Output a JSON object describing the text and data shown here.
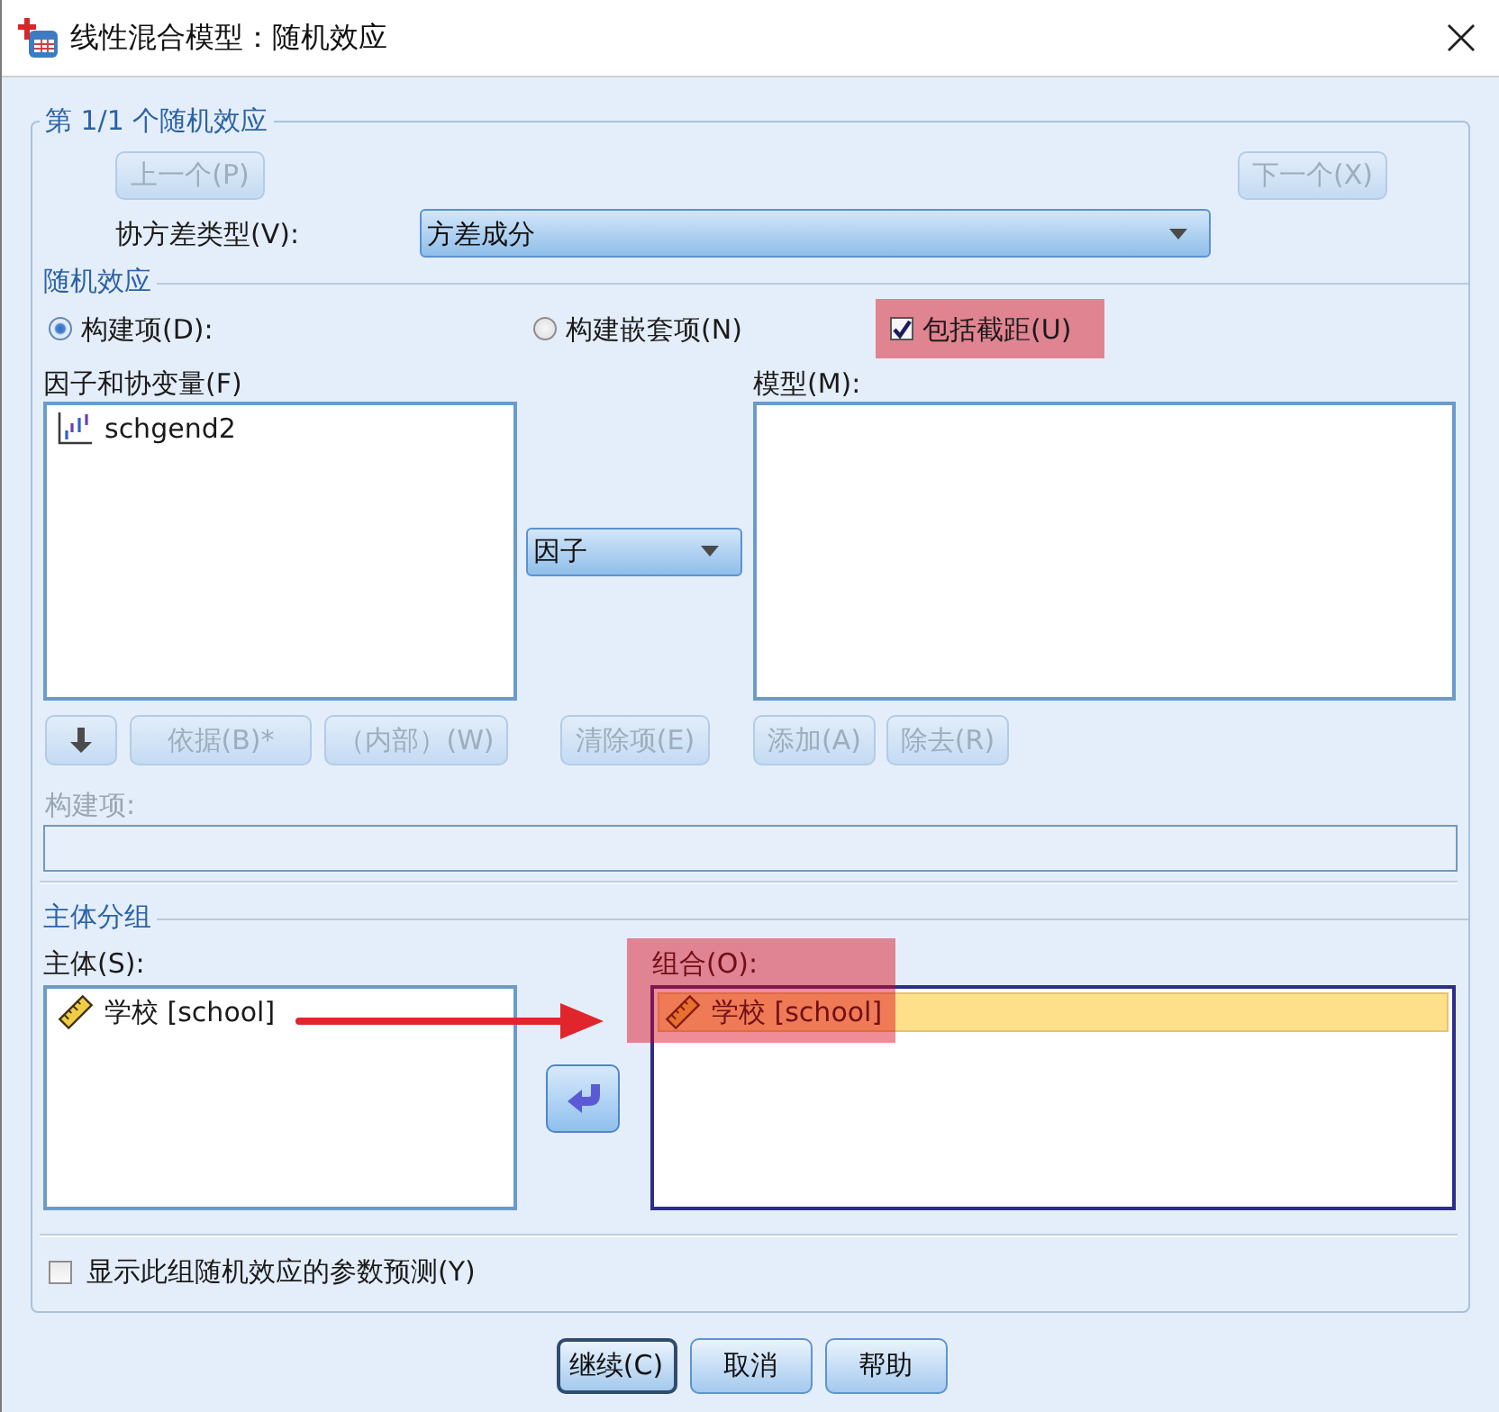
{
  "window": {
    "title": "线性混合模型：随机效应"
  },
  "effect_group": {
    "title": "第 1/1 个随机效应",
    "navigation": [
      {
        "label": "上一个(P)",
        "disabled": true
      },
      {
        "label": "下一个(X)",
        "disabled": true
      }
    ],
    "covariance_type": {
      "label": "协方差类型(V):",
      "value": "方差成分"
    }
  },
  "random_effects": {
    "title": "随机效应",
    "build_options": [
      {
        "label": "构建项(D):",
        "selected": true
      },
      {
        "label": "构建嵌套项(N)",
        "selected": false
      }
    ],
    "include_intercept": {
      "label": "包括截距(U)",
      "checked": true,
      "highlighted": true
    },
    "factors": {
      "label": "因子和协变量(F)",
      "items": [
        {
          "name": "schgend2",
          "kind": "ordinal",
          "selected": false
        }
      ],
      "buttons": [
        {
          "kind": "down_arrow",
          "disabled": true
        },
        {
          "kind": "text",
          "label": "依据(B)*",
          "disabled": true
        },
        {
          "kind": "text",
          "label": "（内部）(W)",
          "disabled": true
        }
      ]
    },
    "term_type": {
      "value": "因子",
      "buttons": [
        {
          "label": "清除项(E)",
          "disabled": true
        }
      ]
    },
    "model": {
      "label": "模型(M):",
      "buttons": [
        {
          "label": "添加(A)",
          "disabled": true
        },
        {
          "label": "除去(R)",
          "disabled": true
        }
      ]
    },
    "build_term": {
      "label": "构建项:",
      "disabled": true
    }
  },
  "subject_grouping": {
    "title": "主体分组",
    "subjects": {
      "label": "主体(S):",
      "items": [
        {
          "name": "学校 [school]",
          "kind": "scale",
          "selected": false
        }
      ]
    },
    "move_button": {
      "disabled": false
    },
    "combinations": {
      "label": "组合(O):",
      "highlighted": true,
      "focused": true,
      "items": [
        {
          "name": "学校 [school]",
          "kind": "scale",
          "selected": true
        }
      ]
    },
    "annotation_arrow": true
  },
  "show_predictions": {
    "label": "显示此组随机效应的参数预测(Y)",
    "checked": false
  },
  "buttons": [
    {
      "label": "继续(C)",
      "default": true
    },
    {
      "label": "取消",
      "default": false
    },
    {
      "label": "帮助",
      "default": false
    }
  ]
}
